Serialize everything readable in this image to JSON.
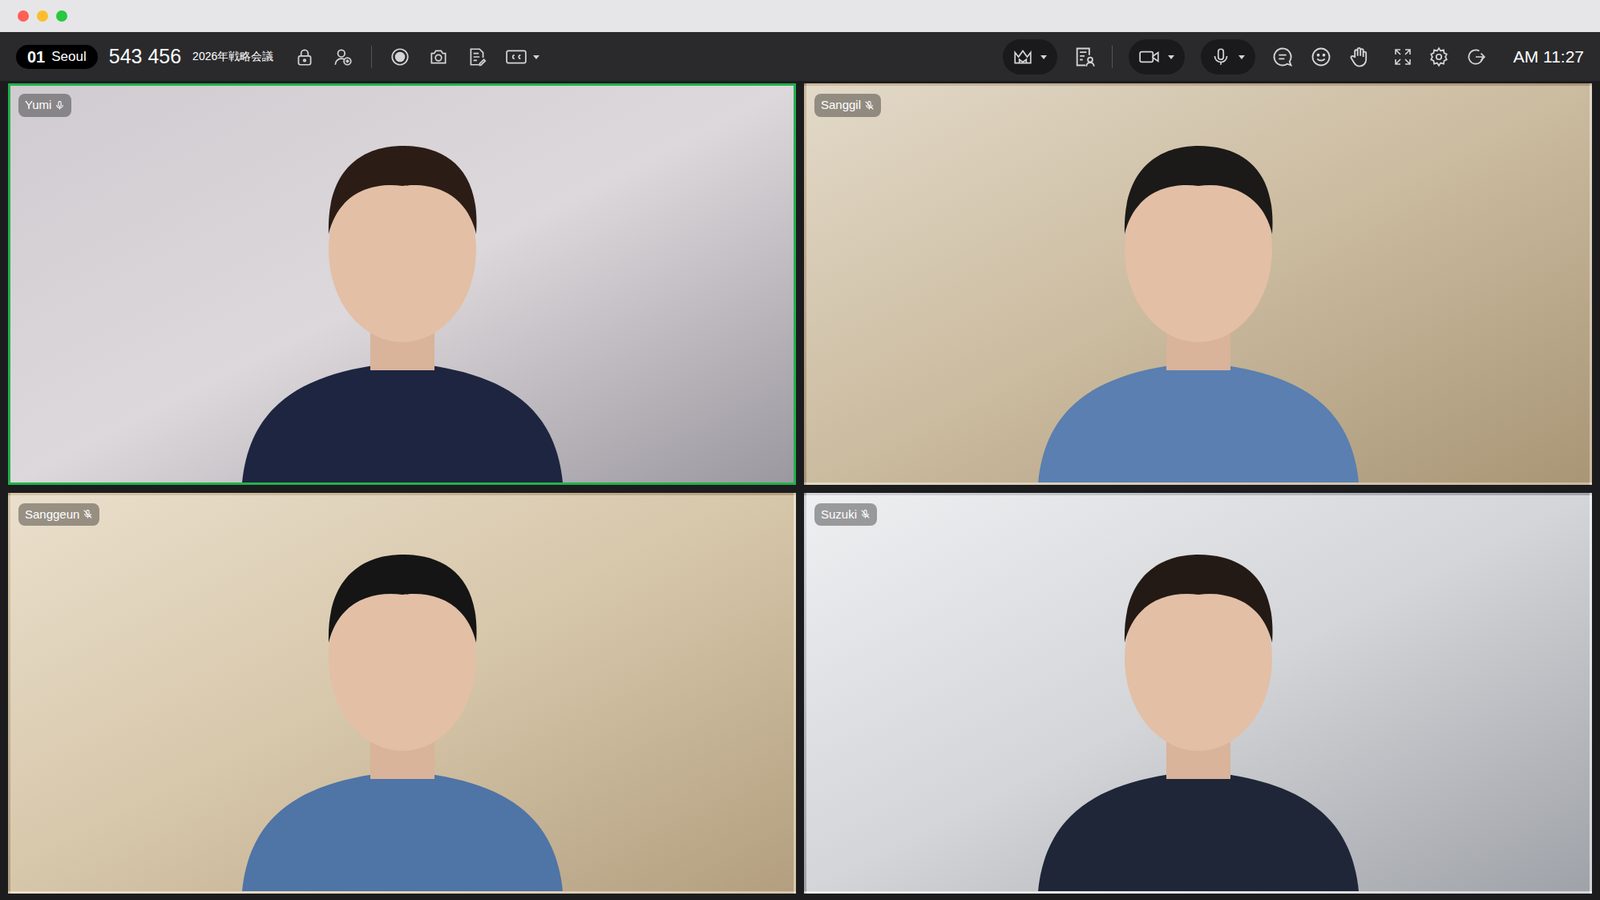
{
  "window": {
    "traffic_lights": [
      {
        "color": "#ff5f57"
      },
      {
        "color": "#febc2e"
      },
      {
        "color": "#28c840"
      }
    ]
  },
  "toolbar": {
    "room_number": "01",
    "room_name": "Seoul",
    "meeting_id": "543 456",
    "meeting_title": "2026年戦略会議",
    "time": "AM 11:27"
  },
  "participants": [
    {
      "name": "Yumi",
      "muted": false,
      "speaking": true
    },
    {
      "name": "Sanggil",
      "muted": true,
      "speaking": false
    },
    {
      "name": "Sanggeun",
      "muted": true,
      "speaking": false
    },
    {
      "name": "Suzuki",
      "muted": true,
      "speaking": false
    }
  ]
}
